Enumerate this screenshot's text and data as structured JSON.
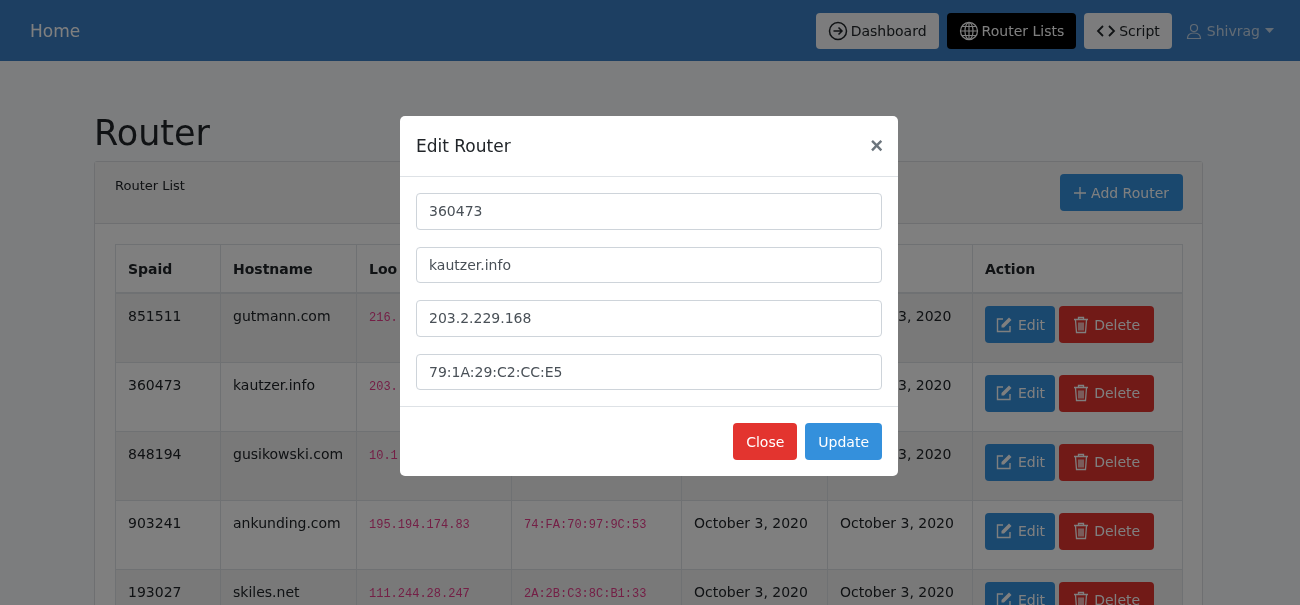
{
  "navbar": {
    "brand": "Home",
    "nav": [
      {
        "label": "Dashboard",
        "selected": false
      },
      {
        "label": "Router Lists",
        "selected": true
      },
      {
        "label": "Script",
        "selected": false
      }
    ],
    "user": "Shivrag"
  },
  "page": {
    "title": "Router"
  },
  "card": {
    "title": "Router List",
    "add_button": "Add Router"
  },
  "table": {
    "columns": [
      "Spaid",
      "Hostname",
      "Loo",
      null,
      null,
      null,
      "Action"
    ],
    "rows": [
      {
        "cells": [
          "851511",
          "gutmann.com",
          "216.",
          null,
          null,
          "3, 2020"
        ],
        "actions": [
          "Edit",
          "Delete"
        ]
      },
      {
        "cells": [
          "360473",
          "kautzer.info",
          "203.",
          null,
          null,
          "3, 2020"
        ],
        "actions": [
          "Edit",
          "Delete"
        ]
      },
      {
        "cells": [
          "848194",
          "gusikowski.com",
          "10.1",
          null,
          null,
          "3, 2020"
        ],
        "actions": [
          "Edit",
          "Delete"
        ]
      },
      {
        "cells": [
          "903241",
          "ankunding.com",
          "195.194.174.83",
          "74:FA:70:97:9C:53",
          "October 3, 2020",
          "October 3, 2020"
        ],
        "actions": [
          "Edit",
          "Delete"
        ]
      },
      {
        "cells": [
          "193027",
          "skiles.net",
          "111.244.28.247",
          "2A:2B:C3:8C:B1:33",
          "October 3, 2020",
          "October 3, 2020"
        ],
        "actions": [
          "Edit",
          "Delete"
        ]
      }
    ]
  },
  "modal": {
    "title": "Edit Router",
    "close_glyph": "×",
    "fields": [
      {
        "value": "360473"
      },
      {
        "value": "kautzer.info"
      },
      {
        "value": "203.2.229.168"
      },
      {
        "value": "79:1A:29:C2:CC:E5"
      }
    ],
    "buttons": [
      {
        "label": "Close",
        "kind": "close"
      },
      {
        "label": "Update",
        "kind": "update"
      }
    ]
  }
}
